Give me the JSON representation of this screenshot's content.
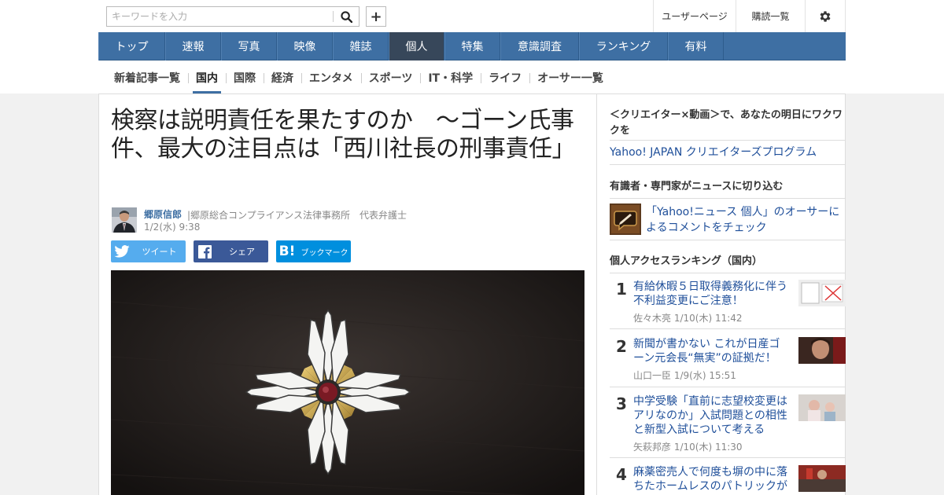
{
  "search": {
    "placeholder": "キーワードを入力"
  },
  "header": {
    "user_page": "ユーザーページ",
    "subscriptions": "購読一覧"
  },
  "global_nav": [
    {
      "label": "トップ"
    },
    {
      "label": "速報"
    },
    {
      "label": "写真"
    },
    {
      "label": "映像"
    },
    {
      "label": "雑誌"
    },
    {
      "label": "個人",
      "active": true
    },
    {
      "label": "特集"
    },
    {
      "label": "意識調査"
    },
    {
      "label": "ランキング"
    },
    {
      "label": "有料"
    }
  ],
  "sub_nav": [
    {
      "label": "新着記事一覧"
    },
    {
      "label": "国内",
      "active": true
    },
    {
      "label": "国際"
    },
    {
      "label": "経済"
    },
    {
      "label": "エンタメ"
    },
    {
      "label": "スポーツ"
    },
    {
      "label": "IT・科学"
    },
    {
      "label": "ライフ"
    },
    {
      "label": "オーサー一覧"
    }
  ],
  "article": {
    "title": "検察は説明責任を果たすのか　～ゴーン氏事件、最大の注目点は「西川社長の刑事責任」",
    "author": "郷原信郎",
    "affiliation": "|郷原総合コンプライアンス法律事務所　代表弁護士",
    "date": "1/2(水) 9:38",
    "share": {
      "tweet": "ツイート",
      "facebook": "シェア",
      "hatena": "ブックマーク"
    }
  },
  "sidebar": {
    "promo_head": "＜クリエイター×動画＞で、あなたの明日にワクワクを",
    "promo_link": "Yahoo! JAPAN クリエイターズプログラム",
    "experts_head": "有識者・専門家がニュースに切り込む",
    "experts_link": "「Yahoo!ニュース 個人」のオーサーによるコメントをチェック",
    "ranking_head": "個人アクセスランキング（国内）",
    "ranking": [
      {
        "num": "1",
        "title": "有給休暇５日取得義務化に伴う不利益変更にご注意！",
        "author": "佐々木亮",
        "date": "1/10(木) 11:42"
      },
      {
        "num": "2",
        "title": "新聞が書かない これが日産ゴーン元会長“無実”の証拠だ！",
        "author": "山口一臣",
        "date": "1/9(水) 15:51"
      },
      {
        "num": "3",
        "title": "中学受験「直前に志望校変更はアリなのか」入試問題との相性と新型入試について考える",
        "author": "矢萩邦彦",
        "date": "1/10(木) 11:30"
      },
      {
        "num": "4",
        "title": "麻薬密売人で何度も塀の中に落ちたホームレスのパトリックが",
        "author": "",
        "date": ""
      }
    ]
  },
  "colors": {
    "nav_blue": "#3e6fa3",
    "nav_active": "#37475a",
    "link": "#1f4f9a",
    "twitter": "#55acee",
    "facebook": "#3b5998",
    "hatena": "#008fde"
  }
}
